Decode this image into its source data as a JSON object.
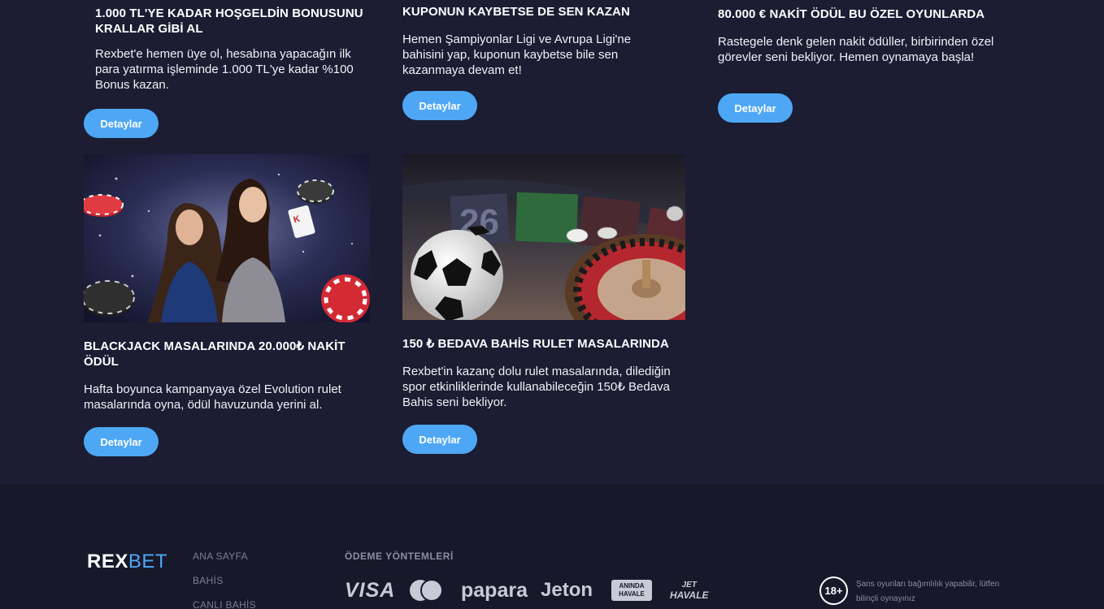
{
  "promos": [
    {
      "title": "1.000 TL'YE KADAR HOŞGELDİN BONUSUNU KRALLAR GİBİ AL",
      "desc": "Rexbet'e hemen üye ol, hesabına yapacağın ilk para yatırma işleminde 1.000 TL'ye kadar %100 Bonus kazan.",
      "button": "Detaylar"
    },
    {
      "title": "KUPONUN KAYBETSE DE SEN KAZAN",
      "desc": "Hemen Şampiyonlar Ligi ve Avrupa Ligi'ne bahisini yap, kuponun kaybetse bile sen kazanmaya devam et!",
      "button": "Detaylar"
    },
    {
      "title": "80.000 € NAKİT ÖDÜL BU ÖZEL OYUNLARDA",
      "desc": "Rastegele denk gelen nakit ödüller, birbirinden özel görevler seni bekliyor. Hemen oynamaya başla!",
      "button": "Detaylar"
    },
    {
      "title": "BLACKJACK MASALARINDA 20.000₺ NAKİT ÖDÜL",
      "desc": "Hafta boyunca kampanyaya özel Evolution rulet masalarında oyna, ödül havuzunda yerini al.",
      "button": "Detaylar"
    },
    {
      "title": "150 ₺ BEDAVA BAHİS RULET MASALARINDA",
      "desc": "Rexbet'in kazanç dolu rulet masalarında, dilediğin spor etkinliklerinde kullanabileceğin 150₺ Bedava Bahis seni bekliyor.",
      "button": "Detaylar"
    }
  ],
  "roulette_number": "26",
  "footer": {
    "logo_rex": "REX",
    "logo_bet": "BET",
    "nav": [
      "ANA SAYFA",
      "BAHİS",
      "CANLI BAHİS"
    ],
    "payments_heading": "ÖDEME YÖNTEMLERİ",
    "payments": [
      "VISA",
      "papara",
      "Jeton",
      "ANINDA",
      "HAVALE",
      "JET",
      "HAVALE"
    ],
    "age_badge": "18+",
    "age_text": "Şans oyunları bağımlılık yapabilir, lütfen bilinçli oynayınız"
  },
  "colors": {
    "background": "#1c1d33",
    "footer": "#171829",
    "accent": "#4ea7f5"
  }
}
